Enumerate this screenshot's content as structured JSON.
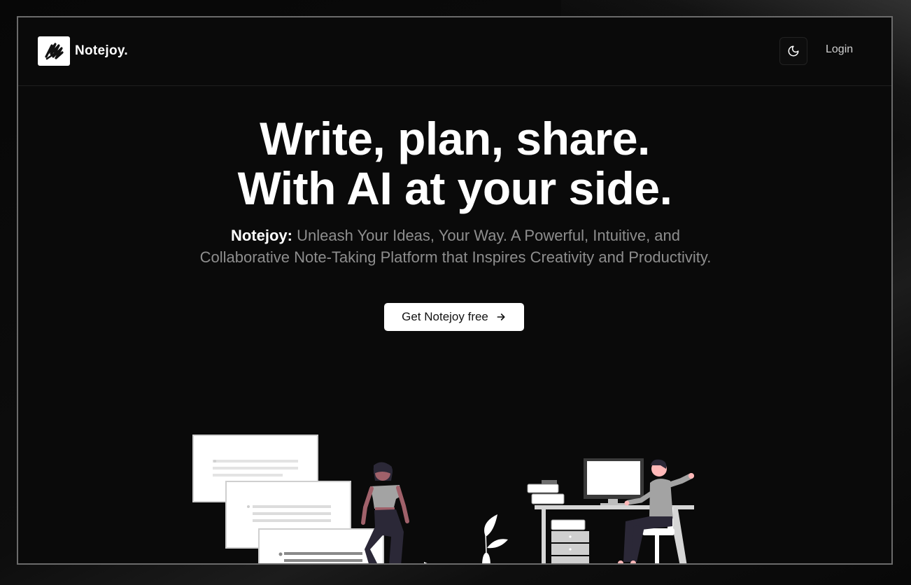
{
  "brand": {
    "name": "Notejoy."
  },
  "nav": {
    "login_label": "Login",
    "theme_icon": "moon-icon"
  },
  "hero": {
    "title_line1": "Write, plan, share.",
    "title_line2": "With AI at your side.",
    "subtitle_lead": "Notejoy:",
    "subtitle_rest": " Unleash Your Ideas, Your Way. A Powerful, Intuitive, and Collaborative Note-Taking Platform that Inspires Creativity and Productivity."
  },
  "cta": {
    "label": "Get Notejoy free",
    "icon": "arrow-right-icon"
  },
  "colors": {
    "background": "#0a0a0a",
    "text": "#ffffff",
    "muted": "#8e8e8e",
    "illustration_gray": "#a3a3a3"
  }
}
